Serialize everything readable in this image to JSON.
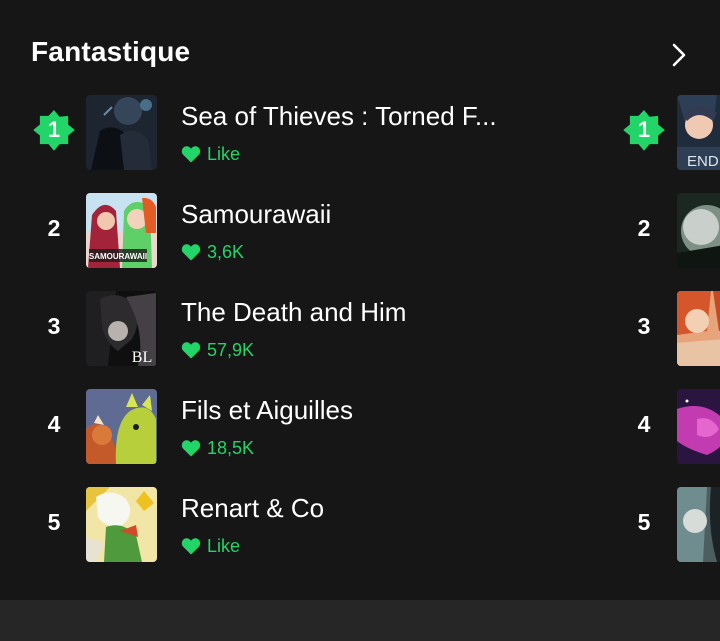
{
  "section": {
    "title": "Fantastique"
  },
  "colors": {
    "accent": "#21d568",
    "background": "#161616"
  },
  "column1": [
    {
      "rank": "1",
      "top": true,
      "title": "Sea of Thieves : Torned F...",
      "likes": "Like"
    },
    {
      "rank": "2",
      "top": false,
      "title": "Samourawaii",
      "likes": "3,6K"
    },
    {
      "rank": "3",
      "top": false,
      "title": "The Death and Him",
      "likes": "57,9K"
    },
    {
      "rank": "4",
      "top": false,
      "title": "Fils et Aiguilles",
      "likes": "18,5K"
    },
    {
      "rank": "5",
      "top": false,
      "title": "Renart & Co",
      "likes": "Like"
    }
  ],
  "column2": [
    {
      "rank": "1",
      "top": true
    },
    {
      "rank": "2",
      "top": false
    },
    {
      "rank": "3",
      "top": false
    },
    {
      "rank": "4",
      "top": false
    },
    {
      "rank": "5",
      "top": false
    }
  ],
  "thumb_text": {
    "samourawaii": "SAMOURAWAII",
    "death": "BL",
    "end": "END"
  }
}
